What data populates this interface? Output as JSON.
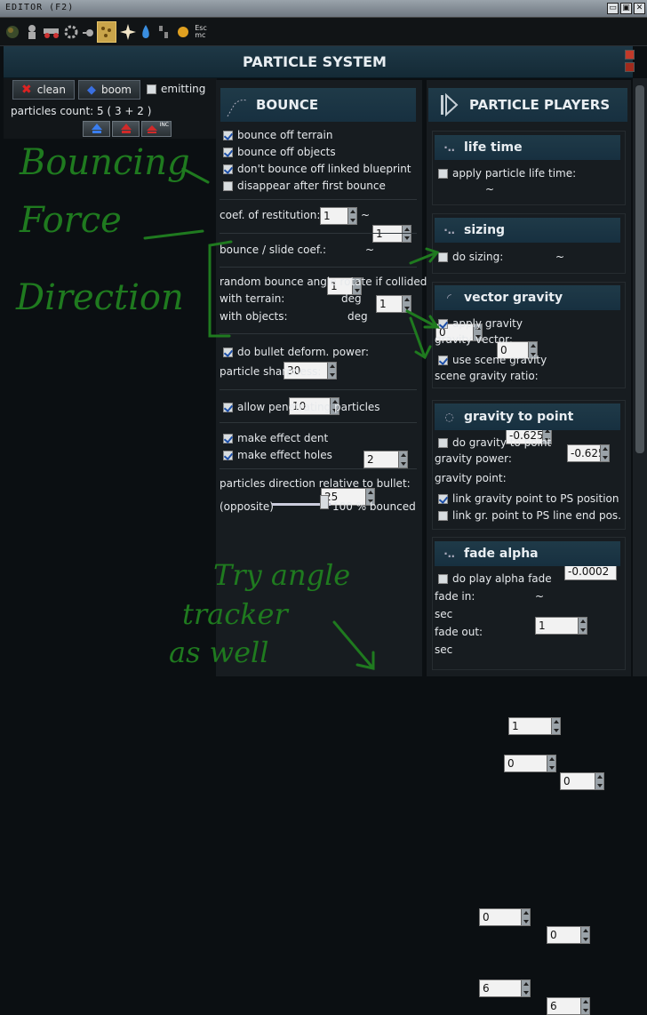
{
  "window": {
    "title": "EDITOR (F2)",
    "buttons": [
      "▭",
      "▣",
      "✕"
    ]
  },
  "toolbar": {
    "icons": [
      "world-icon",
      "robot-icon",
      "vehicle-icon",
      "gear-icon",
      "drone-icon",
      "particles-icon",
      "explosion-icon",
      "water-drop-icon",
      "barrel-icon",
      "sun-icon",
      "esc-menu-icon"
    ],
    "esc_label": "Esc\nmc"
  },
  "header": {
    "title": "PARTICLE SYSTEM"
  },
  "left": {
    "clean_label": "clean",
    "boom_label": "boom",
    "emitting_label": "emitting",
    "particles_count": "particles count: 5 ( 3 + 2 )",
    "small_btn3": "INC"
  },
  "bounce": {
    "title": "BOUNCE",
    "off_terrain": "bounce off terrain",
    "off_objects": "bounce off objects",
    "no_linked": "don't bounce off linked blueprint",
    "disappear": "disappear after first bounce",
    "restitution_label": "coef. of restitution:",
    "restitution_min": "1",
    "restitution_max": "1",
    "slide_label": "bounce / slide coef.:",
    "slide_min": "1",
    "slide_max": "1",
    "random_label": "random bounce angle rotate if collided",
    "terrain_label": "with terrain:",
    "terrain_val": "30",
    "objects_label": "with objects:",
    "objects_val": "10",
    "deg": "deg",
    "deform_label": "do bullet deform. power:",
    "deform_val": "2",
    "sharp_label": "particle sharpness:",
    "sharp_val": "25",
    "penetrating": "allow penetrating particles",
    "dent": "make effect dent",
    "holes": "make effect holes",
    "direction_label": "particles direction relative to bullet:",
    "opposite": "(opposite)",
    "bounced": "100 % bounced",
    "slider_value": 1.0
  },
  "players": {
    "title": "PARTICLE PLAYERS",
    "lifetime": {
      "title": "life time",
      "apply": "apply particle life time:",
      "min": "0",
      "max": "0"
    },
    "sizing": {
      "title": "sizing",
      "do": "do sizing:",
      "min": "-0.625",
      "max": "-0.625"
    },
    "vgravity": {
      "title": "vector gravity",
      "apply": "apply gravity",
      "vector_label": "gravity vector:",
      "vx": "0",
      "vy": "-0.0002",
      "scene": "use scene gravity",
      "ratio_label": "scene gravity ratio:",
      "ratio": "1"
    },
    "gpoint": {
      "title": "gravity to point",
      "do": "do gravity to point",
      "power_label": "gravity power:",
      "power": "1",
      "point_label": "gravity point:",
      "px": "0",
      "py": "0",
      "link1": "link gravity point to PS position",
      "link2": "link gr. point to PS line end pos."
    },
    "fade": {
      "title": "fade alpha",
      "do": "do play alpha fade",
      "in_label": "fade in:",
      "in_min": "0",
      "in_max": "0",
      "sec": "sec",
      "out_label": "fade out:",
      "out_min": "6",
      "out_max": "6"
    }
  },
  "annotations": {
    "a1": "Bouncing",
    "a2": "Force",
    "a3": "Direction",
    "a4": "Try angle",
    "a5": "tracker",
    "a6": "as well"
  },
  "colors": {
    "accent": "#1f3a48",
    "ink": "#1f7a1f",
    "clean_x": "#c22",
    "boom_icon": "#2a5fd0"
  }
}
